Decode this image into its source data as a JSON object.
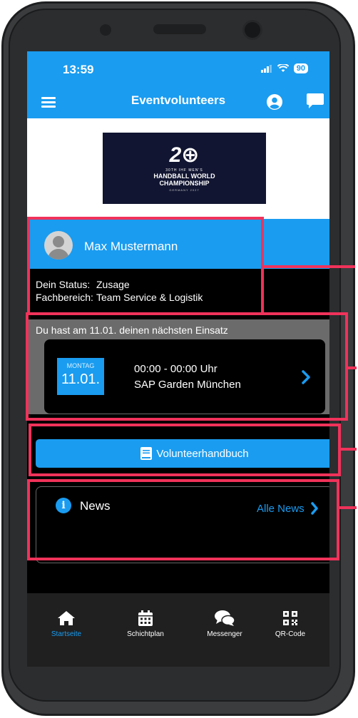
{
  "status_bar": {
    "time": "13:59",
    "battery": "90"
  },
  "header": {
    "title": "Eventvolunteers",
    "menu_icon": "hamburger-menu-icon",
    "account_icon": "user-circle-icon",
    "chat_icon": "chat-bubble-icon"
  },
  "banner": {
    "mark_year": "2",
    "mark_ball": "⊕",
    "line1": "30TH IHF MEN'S",
    "line2": "HANDBALL WORLD",
    "line3": "CHAMPIONSHIP",
    "line4": "GERMANY 2027"
  },
  "profile": {
    "name": "Max Mustermann",
    "status_label": "Dein Status:",
    "status_value": "Zusage",
    "area_label": "Fachbereich:",
    "area_value": "Team Service & Logistik"
  },
  "next_assignment": {
    "heading": "Du hast am 11.01. deinen nächsten Einsatz",
    "weekday": "MONTAG",
    "date": "11.01.",
    "time": "00:00 - 00:00 Uhr",
    "location": "SAP Garden München"
  },
  "handbook": {
    "label": "Volunteerhandbuch",
    "icon": "book-icon"
  },
  "news": {
    "title": "News",
    "link_label": "Alle News",
    "icon": "info-icon"
  },
  "tabs": [
    {
      "label": "Startseite",
      "icon": "home-icon",
      "active": true
    },
    {
      "label": "Schichtplan",
      "icon": "calendar-icon",
      "active": false
    },
    {
      "label": "Messenger",
      "icon": "chat-bubbles-icon",
      "active": false
    },
    {
      "label": "QR-Code",
      "icon": "qr-code-icon",
      "active": false
    }
  ],
  "colors": {
    "accent": "#1a9cf0",
    "highlight": "#f0325a",
    "frame": "#3a3c3e"
  }
}
